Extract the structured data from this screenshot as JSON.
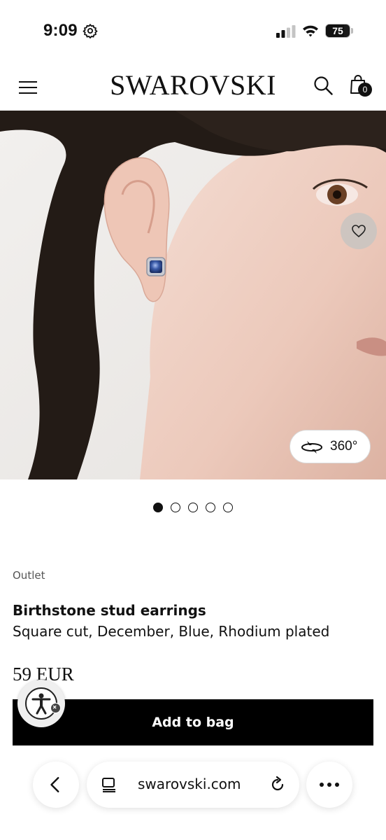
{
  "status_bar": {
    "time": "9:09",
    "battery_percent": "75",
    "icons": [
      "gear-icon",
      "cellular-signal-icon",
      "wifi-icon",
      "battery-icon"
    ]
  },
  "header": {
    "brand": "SWAROVSKI",
    "bag_count": "0",
    "icons": [
      "hamburger-menu-icon",
      "search-icon",
      "shopping-bag-icon"
    ]
  },
  "gallery": {
    "view_360_label": "360°",
    "slide_count": 5,
    "active_slide": 1,
    "icons": [
      "heart-icon",
      "rotate-360-icon"
    ]
  },
  "product": {
    "breadcrumb": "Outlet",
    "name": "Birthstone stud earrings",
    "description": "Square cut, December, Blue, Rhodium plated",
    "price": "59 EUR",
    "add_to_bag_label": "Add to bag"
  },
  "browser": {
    "url": "swarovski.com",
    "icons": [
      "back-chevron-icon",
      "tabs-icon",
      "reload-icon",
      "more-dots-icon",
      "accessibility-icon"
    ]
  },
  "colors": {
    "primary": "#000000",
    "background": "#ffffff",
    "earring_crystal": "#3a5aa8"
  }
}
